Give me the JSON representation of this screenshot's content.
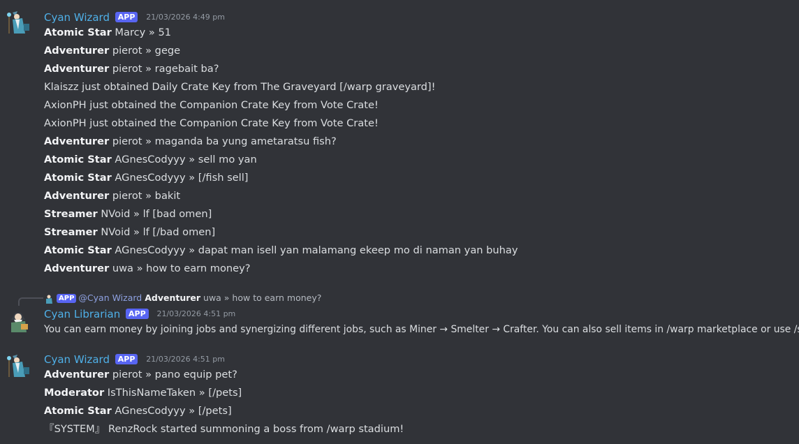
{
  "groups": [
    {
      "author": "Cyan Wizard",
      "tag": "APP",
      "timestamp": "21/03/2026 4:49 pm",
      "lines": [
        {
          "rank": "Atomic Star",
          "text": "Marcy » 51"
        },
        {
          "rank": "Adventurer",
          "text": "pierot » gege"
        },
        {
          "rank": "Adventurer",
          "text": "pierot » ragebait ba?"
        },
        {
          "rank": "",
          "text": "Klaiszz just obtained Daily Crate Key from The Graveyard [/warp graveyard]!"
        },
        {
          "rank": "",
          "text": "AxionPH just obtained the Companion Crate Key from Vote Crate!"
        },
        {
          "rank": "",
          "text": "AxionPH just obtained the Companion Crate Key from Vote Crate!"
        },
        {
          "rank": "Adventurer",
          "text": "pierot » maganda ba yung ametaratsu fish?"
        },
        {
          "rank": "Atomic Star",
          "text": "AGnesCodyyy » sell mo yan"
        },
        {
          "rank": "Atomic Star",
          "text": "AGnesCodyyy » [/fish sell]"
        },
        {
          "rank": "Adventurer",
          "text": "pierot » bakit"
        },
        {
          "rank": "Streamer",
          "text": "NVoid » lf [bad omen]"
        },
        {
          "rank": "Streamer",
          "text": "NVoid » lf [/bad omen]"
        },
        {
          "rank": "Atomic Star",
          "text": "AGnesCodyyy » dapat man isell yan malamang ekeep mo di naman yan buhay"
        },
        {
          "rank": "Adventurer",
          "text": "uwa » how to earn money?"
        }
      ]
    },
    {
      "reply": {
        "tag": "APP",
        "mention": "@Cyan Wizard",
        "rank": "Adventurer",
        "text": "uwa » how to earn money?"
      },
      "author": "Cyan Librarian",
      "tag": "APP",
      "timestamp": "21/03/2026 4:51 pm",
      "lines": [
        {
          "rank": "",
          "text": "You can earn money by joining jobs and synergizing different jobs, such as Miner → Smelter → Crafter. You can also sell items in /warp marketplace or use /sell."
        }
      ]
    },
    {
      "author": "Cyan Wizard",
      "tag": "APP",
      "timestamp": "21/03/2026 4:51 pm",
      "lines": [
        {
          "rank": "Adventurer",
          "text": "pierot » pano equip pet?"
        },
        {
          "rank": "Moderator",
          "text": "IsThisNameTaken » [/pets]"
        },
        {
          "rank": "Atomic Star",
          "text": "AGnesCodyyy » [/pets]"
        },
        {
          "rank": "",
          "text": "『SYSTEM』 RenzRock started summoning a boss from /warp stadium!"
        }
      ]
    }
  ],
  "icons": {
    "wizard_avatar": "wizard-avatar-icon",
    "librarian_avatar": "librarian-avatar-icon"
  },
  "colors": {
    "background": "#313338",
    "author": "#4fb0e8",
    "app_tag": "#5865f2",
    "mention": "#8ea1e1"
  }
}
